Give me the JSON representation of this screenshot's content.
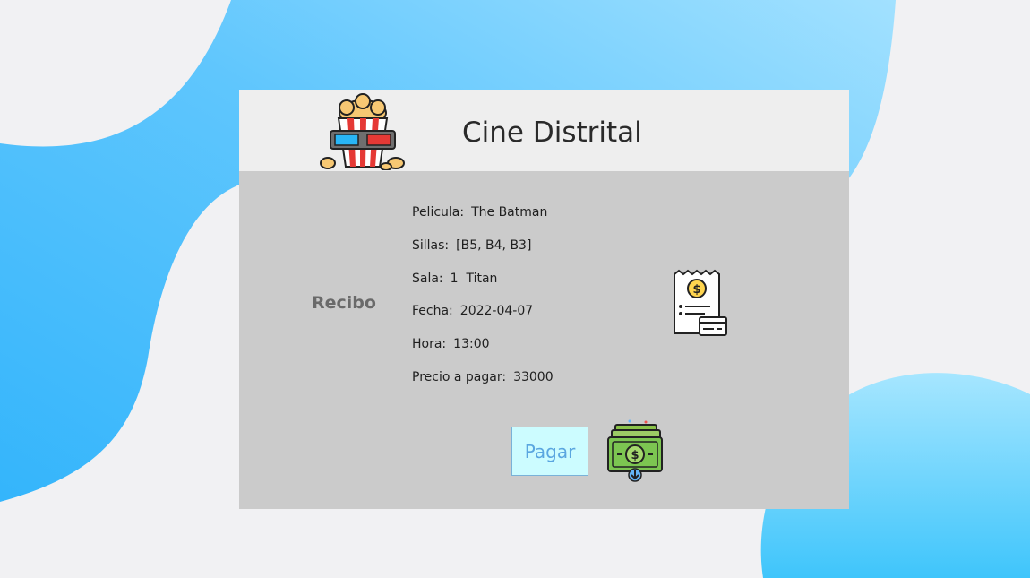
{
  "header": {
    "title": "Cine Distrital"
  },
  "receipt": {
    "section_label": "Recibo",
    "fields": [
      {
        "label": "Pelicula:",
        "value": "The Batman"
      },
      {
        "label": "Sillas:",
        "value": "[B5, B4, B3]"
      },
      {
        "label": "Sala:",
        "value": "1  Titan"
      },
      {
        "label": "Fecha:",
        "value": "2022-04-07"
      },
      {
        "label": "Hora:",
        "value": "13:00"
      },
      {
        "label": "Precio a pagar:",
        "value": "33000"
      }
    ]
  },
  "actions": {
    "pay_label": "Pagar"
  },
  "icons": {
    "logo": "popcorn-3d-glasses-icon",
    "receipt": "receipt-card-icon",
    "money": "money-download-icon"
  },
  "colors": {
    "page_bg": "#f1f1f3",
    "blob_blue": "#5ec6fc",
    "card_body": "#cbcbcb",
    "card_header": "#eeeeee",
    "pay_button_bg": "#ccfcff",
    "pay_button_text": "#5aa6e0"
  }
}
